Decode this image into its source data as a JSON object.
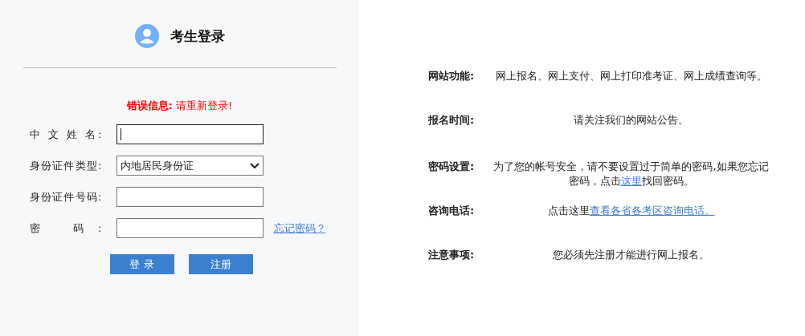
{
  "login": {
    "title": "考生登录",
    "error": "**错误信息:** 请重新登录!",
    "fields": [
      {
        "kind": "text",
        "label": "中 文 姓 名:",
        "focused": true
      },
      {
        "kind": "select",
        "label": "身份证件类型:",
        "value": "内地居民身份证",
        "focused": false
      },
      {
        "kind": "text",
        "label": "身份证件号码:",
        "focused": false
      },
      {
        "kind": "password",
        "label": "密 码:",
        "focused": false,
        "link": "忘记密码？"
      }
    ],
    "buttons": [
      "登 录",
      "注册"
    ]
  },
  "info": [
    {
      "label": "网站功能:",
      "parts": [
        {
          "kind": "text",
          "text": "网上报名、网上支付、网上打印准考证、网上成绩查询等。"
        }
      ]
    },
    {
      "label": "报名时间:",
      "parts": [
        {
          "kind": "text",
          "text": "请关注我们的网站公告。"
        }
      ]
    },
    {
      "label": "密码设置:",
      "parts": [
        {
          "kind": "text",
          "text": "为了您的帐号安全，请不要设置过于简单的密码,如果您忘记密码，点击"
        },
        {
          "kind": "link",
          "text": "这里"
        },
        {
          "kind": "text",
          "text": "找回密码。"
        }
      ]
    },
    {
      "label": "咨询电话:",
      "parts": [
        {
          "kind": "text",
          "text": "点击这里"
        },
        {
          "kind": "link",
          "text": "查看各省各考区咨询电话。"
        }
      ]
    },
    {
      "label": "注意事项:",
      "parts": [
        {
          "kind": "text",
          "text": "您必须先注册才能进行网上报名。"
        }
      ]
    }
  ]
}
